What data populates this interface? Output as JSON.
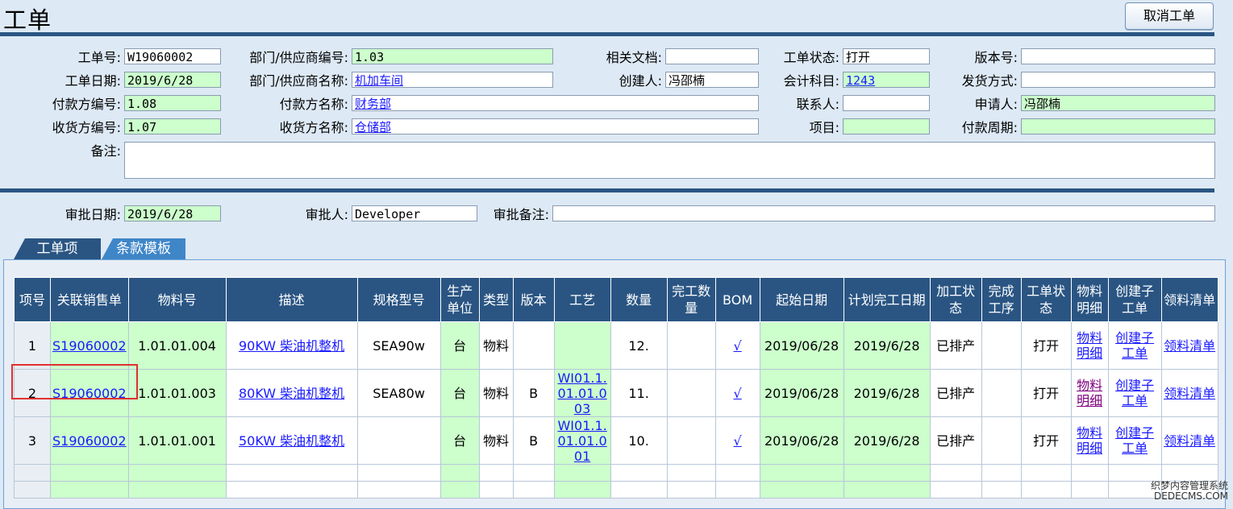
{
  "page": {
    "title": "工单",
    "cancel_label": "取消工单"
  },
  "form": {
    "order_no": {
      "label": "工单号:",
      "value": "W19060002"
    },
    "dept_no": {
      "label": "部门/供应商编号:",
      "value": "1.03"
    },
    "related_doc": {
      "label": "相关文档:",
      "value": ""
    },
    "order_status": {
      "label": "工单状态:",
      "value": "打开"
    },
    "version_no": {
      "label": "版本号:",
      "value": ""
    },
    "order_date": {
      "label": "工单日期:",
      "value": "2019/6/28"
    },
    "dept_name": {
      "label": "部门/供应商名称:",
      "value": "机加车间"
    },
    "creator": {
      "label": "创建人:",
      "value": "冯邵楠"
    },
    "account": {
      "label": "会计科目:",
      "value": "1243"
    },
    "ship_method": {
      "label": "发货方式:",
      "value": ""
    },
    "payer_no": {
      "label": "付款方编号:",
      "value": "1.08"
    },
    "payer_name": {
      "label": "付款方名称:",
      "value": "财务部"
    },
    "contact": {
      "label": "联系人:",
      "value": ""
    },
    "applicant": {
      "label": "申请人:",
      "value": "冯邵楠"
    },
    "receiver_no": {
      "label": "收货方编号:",
      "value": "1.07"
    },
    "receiver_name": {
      "label": "收货方名称:",
      "value": "仓储部"
    },
    "project": {
      "label": "项目:",
      "value": ""
    },
    "pay_period": {
      "label": "付款周期:",
      "value": ""
    },
    "remark": {
      "label": "备注:",
      "value": ""
    }
  },
  "approval": {
    "date": {
      "label": "审批日期:",
      "value": "2019/6/28"
    },
    "approver": {
      "label": "审批人:",
      "value": "Developer"
    },
    "remark": {
      "label": "审批备注:",
      "value": ""
    }
  },
  "tabs": [
    "工单项",
    "条款模板"
  ],
  "table": {
    "headers": [
      "项号",
      "关联销售单",
      "物料号",
      "描述",
      "规格型号",
      "生产单位",
      "类型",
      "版本",
      "工艺",
      "数量",
      "完工数量",
      "BOM",
      "起始日期",
      "计划完工日期",
      "加工状态",
      "完成工序",
      "工单状态",
      "物料明细",
      "创建子工单",
      "领料清单"
    ],
    "rows": [
      [
        "1",
        "S19060002",
        "1.01.01.004",
        "90KW 柴油机整机",
        "SEA90w",
        "台",
        "物料",
        "",
        "",
        "12.",
        "",
        "√",
        "2019/06/28",
        "2019/6/28",
        "已排产",
        "",
        "打开",
        "物料明细",
        "创建子工单",
        "领料清单"
      ],
      [
        "2",
        "S19060002",
        "1.01.01.003",
        "80KW 柴油机整机",
        "SEA80w",
        "台",
        "物料",
        "B",
        "WI01.1.01.01.003",
        "11.",
        "",
        "√",
        "2019/06/28",
        "2019/6/28",
        "已排产",
        "",
        "打开",
        "物料明细",
        "创建子工单",
        "领料清单"
      ],
      [
        "3",
        "S19060002",
        "1.01.01.001",
        "50KW 柴油机整机",
        "",
        "台",
        "物料",
        "B",
        "WI01.1.01.01.001",
        "10.",
        "",
        "√",
        "2019/06/28",
        "2019/6/28",
        "已排产",
        "",
        "打开",
        "物料明细",
        "创建子工单",
        "领料清单"
      ]
    ]
  },
  "watermark": {
    "line1": "织梦内容管理系统",
    "line2": "DEDECMS.COM"
  },
  "colors": {
    "header_blue": "#2a5583",
    "field_green": "#ccffcc",
    "highlight_red": "#e03030",
    "link_blue": "#1a1aff"
  }
}
